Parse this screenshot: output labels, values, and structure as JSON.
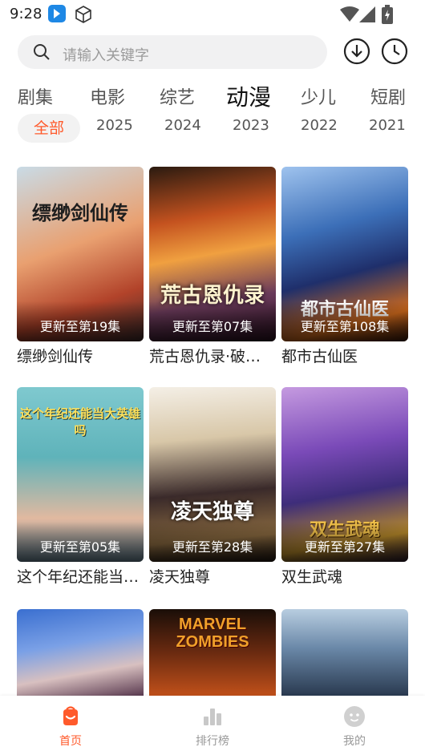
{
  "status_bar": {
    "time": "9:28"
  },
  "search": {
    "placeholder": "请输入关键字"
  },
  "categories": [
    "剧集",
    "电影",
    "综艺",
    "动漫",
    "少儿",
    "短剧"
  ],
  "active_category": "动漫",
  "years": [
    "全部",
    "2025",
    "2024",
    "2023",
    "2022",
    "2021"
  ],
  "active_year": "全部",
  "items": [
    {
      "title": "缥缈剑仙传",
      "episode": "更新至第19集",
      "poster_text": "缥缈剑仙传"
    },
    {
      "title": "荒古恩仇录·破…",
      "episode": "更新至第07集",
      "poster_text": "荒古恩仇录"
    },
    {
      "title": "都市古仙医",
      "episode": "更新至第108集",
      "poster_text": "都市古仙医"
    },
    {
      "title": "这个年纪还能当…",
      "episode": "更新至第05集",
      "poster_text": "这个年纪还能当大英雄吗"
    },
    {
      "title": "凌天独尊",
      "episode": "更新至第28集",
      "poster_text": "凌天独尊"
    },
    {
      "title": "双生武魂",
      "episode": "更新至第27集",
      "poster_text": "双生武魂"
    },
    {
      "poster_text": ""
    },
    {
      "poster_text": "MARVEL ZOMBIES"
    },
    {
      "poster_text": ""
    }
  ],
  "bottom_nav": [
    {
      "label": "首页",
      "icon": "home-icon",
      "active": true
    },
    {
      "label": "排行榜",
      "icon": "bar-chart-icon",
      "active": false
    },
    {
      "label": "我的",
      "icon": "profile-icon",
      "active": false
    }
  ],
  "colors": {
    "accent": "#ff5a2b",
    "app_badge": "#1e88e5"
  }
}
